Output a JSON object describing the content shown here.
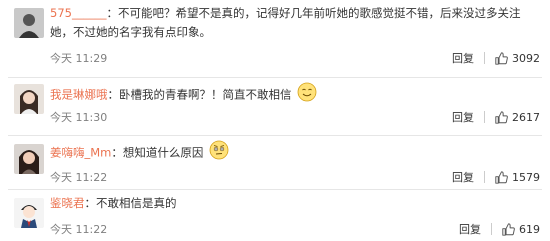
{
  "comments": [
    {
      "username": "575______",
      "text": "：不可能吧？希望不是真的，记得好几年前听她的歌感觉挺不错，后来没过多关注她，不过她的名字我有点印象。",
      "time": "今天 11:29",
      "reply_label": "回复",
      "likes": "3092",
      "avatar_icon": "avatar-dark"
    },
    {
      "username": "我是琳娜哦",
      "text": "：卧槽我的青春啊？！简直不敢相信",
      "time": "今天 11:30",
      "reply_label": "回复",
      "likes": "2617",
      "emoji_icon": "smile-emoji",
      "avatar_icon": "avatar-girl"
    },
    {
      "username": "姜嗨嗨_Mm",
      "text": "：想知道什么原因",
      "time": "今天 11:22",
      "reply_label": "回复",
      "likes": "1579",
      "emoji_icon": "thinking-emoji",
      "avatar_icon": "avatar-woman"
    },
    {
      "username": "鉴晓君",
      "text": "：不敢相信是真的",
      "time": "今天 11:22",
      "reply_label": "回复",
      "likes": "619",
      "avatar_icon": "avatar-cartoon"
    }
  ],
  "colors": {
    "username": "#eb7350",
    "text": "#333333",
    "meta": "#808080"
  }
}
